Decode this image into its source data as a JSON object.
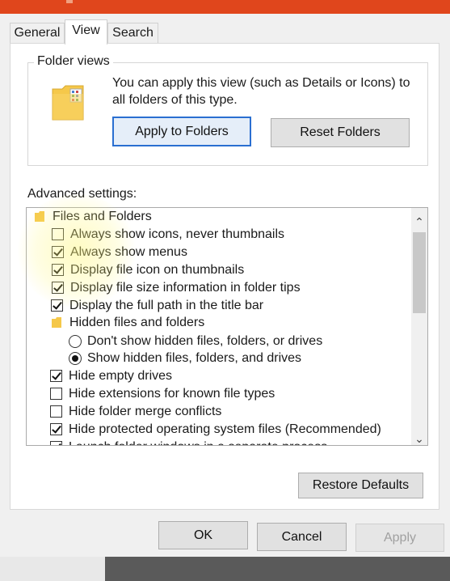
{
  "tabs": [
    {
      "label": "General"
    },
    {
      "label": "View"
    },
    {
      "label": "Search"
    }
  ],
  "folder_views": {
    "legend": "Folder views",
    "description": "You can apply this view (such as Details or Icons) to all folders of this type.",
    "apply_button": "Apply to Folders",
    "reset_button": "Reset Folders"
  },
  "advanced": {
    "label": "Advanced settings:",
    "items": [
      {
        "type": "folder",
        "label": "Files and Folders"
      },
      {
        "type": "checkbox",
        "checked": false,
        "label": "Always show icons, never thumbnails"
      },
      {
        "type": "checkbox",
        "checked": true,
        "label": "Always show menus"
      },
      {
        "type": "checkbox",
        "checked": true,
        "label": "Display file icon on thumbnails"
      },
      {
        "type": "checkbox",
        "checked": true,
        "label": "Display file size information in folder tips"
      },
      {
        "type": "checkbox",
        "checked": true,
        "label": "Display the full path in the title bar"
      },
      {
        "type": "folder",
        "label": "Hidden files and folders"
      },
      {
        "type": "radio",
        "checked": false,
        "label": "Don't show hidden files, folders, or drives"
      },
      {
        "type": "radio",
        "checked": true,
        "label": "Show hidden files, folders, and drives"
      },
      {
        "type": "checkbox",
        "checked": true,
        "label": "Hide empty drives"
      },
      {
        "type": "checkbox",
        "checked": false,
        "label": "Hide extensions for known file types"
      },
      {
        "type": "checkbox",
        "checked": false,
        "label": "Hide folder merge conflicts"
      },
      {
        "type": "checkbox",
        "checked": true,
        "label": "Hide protected operating system files (Recommended)"
      },
      {
        "type": "checkbox",
        "checked": true,
        "label": "Launch folder windows in a separate process"
      }
    ],
    "restore_button": "Restore Defaults"
  },
  "footer": {
    "ok": "OK",
    "cancel": "Cancel",
    "apply": "Apply"
  },
  "colors": {
    "titlebar": "#e0461c",
    "focus_border": "#2a6fd1",
    "folder_yellow": "#f5c84a"
  }
}
